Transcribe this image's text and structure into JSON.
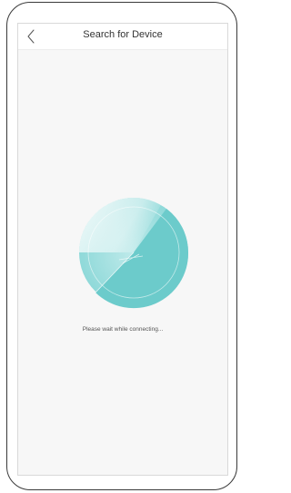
{
  "header": {
    "title": "Search for Device",
    "back_icon": "chevron-left-icon"
  },
  "status": {
    "message": "Please wait while connecting..."
  },
  "colors": {
    "accent": "#72cfcf",
    "accent_dark": "#5bbfbf",
    "background": "#f7f7f7",
    "navbar": "#ffffff"
  }
}
